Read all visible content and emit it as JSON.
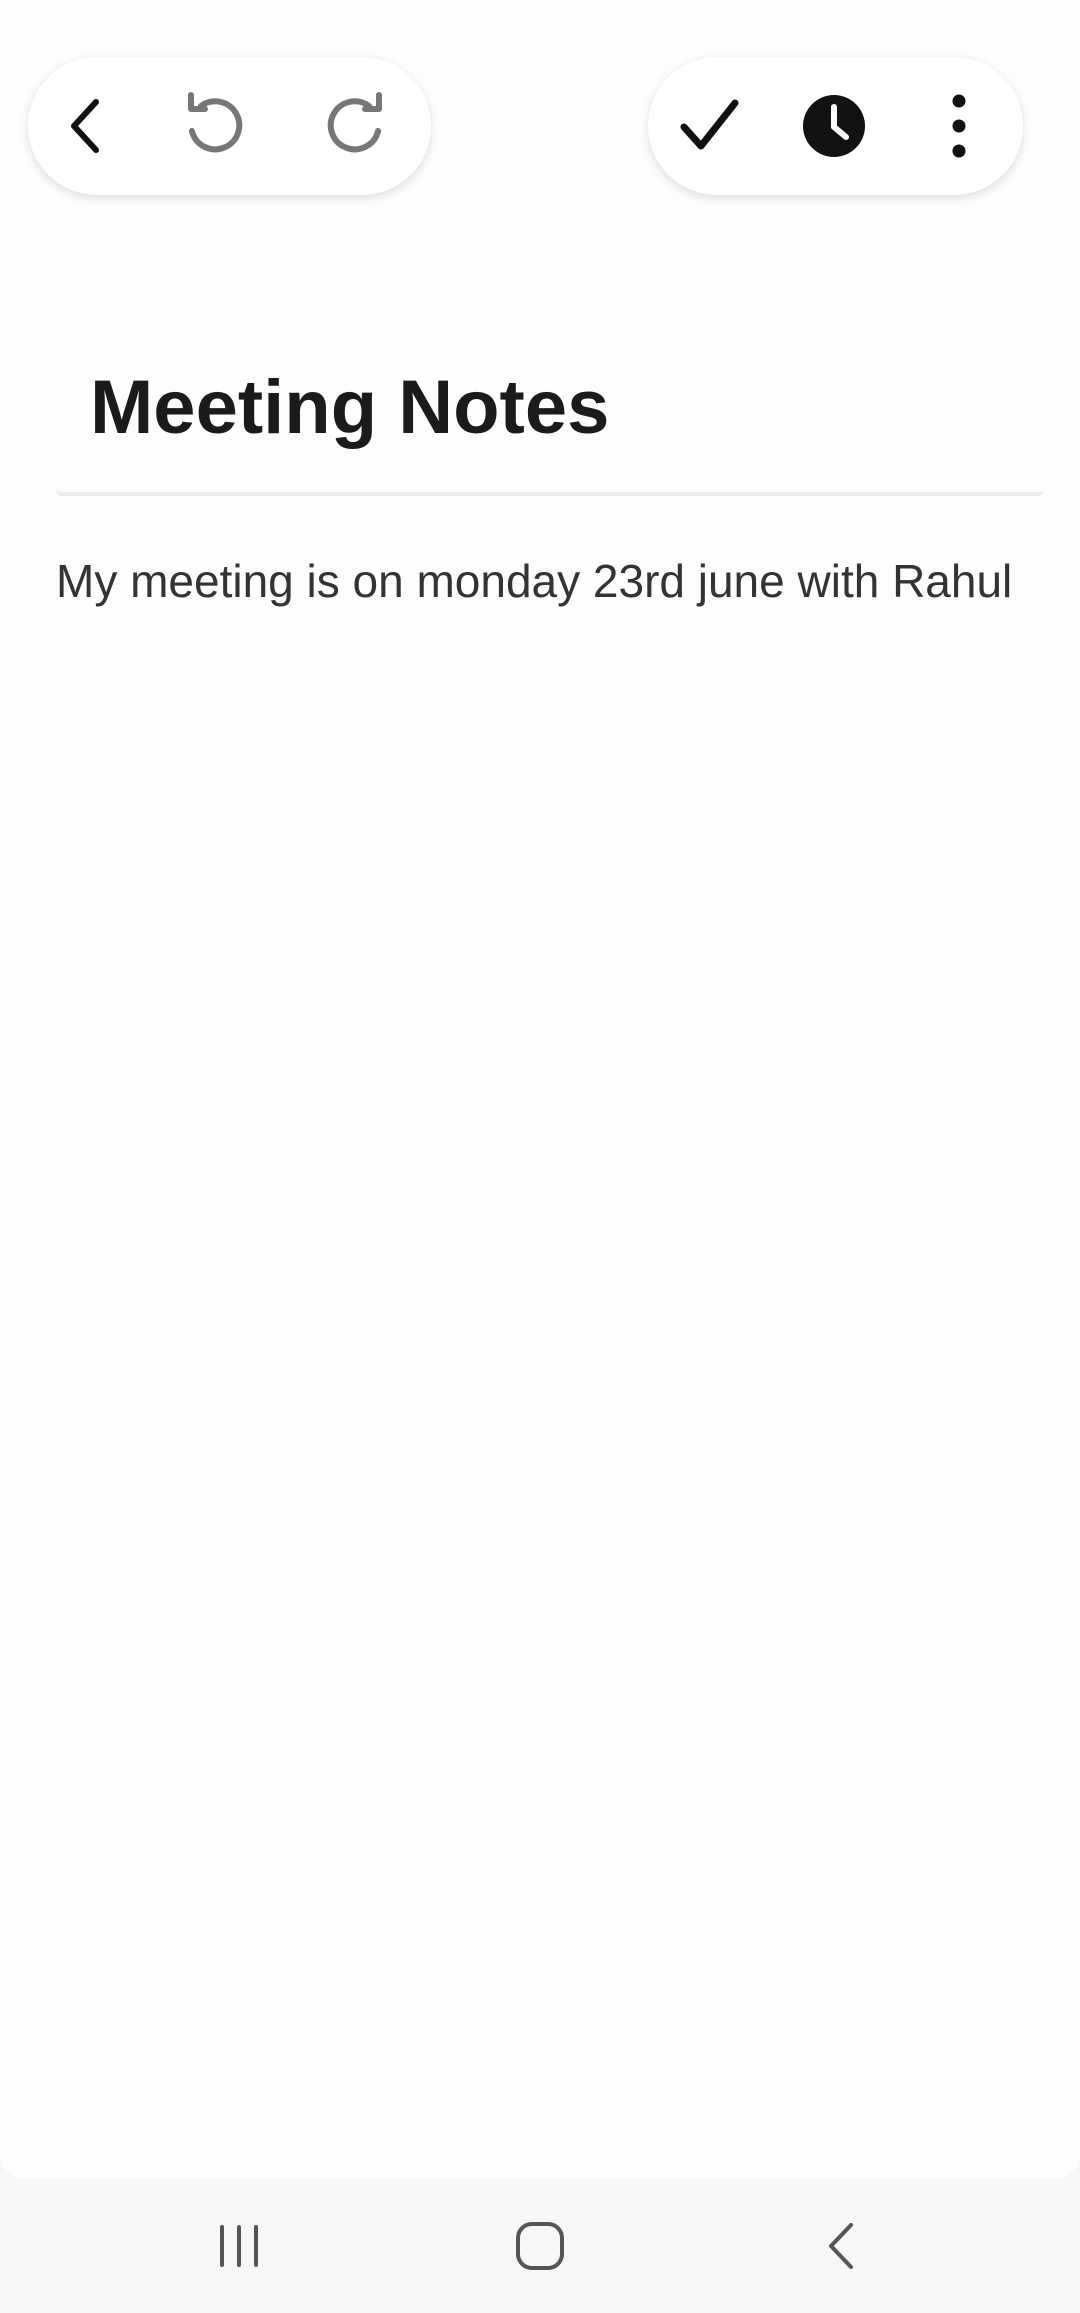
{
  "toolbar": {
    "left": [
      {
        "icon": "back-arrow-icon",
        "label": "Back"
      },
      {
        "icon": "undo-icon",
        "label": "Undo"
      },
      {
        "icon": "redo-icon",
        "label": "Redo"
      }
    ],
    "right": [
      {
        "icon": "checkmark-icon",
        "label": "Save"
      },
      {
        "icon": "clock-icon",
        "label": "Reminder"
      },
      {
        "icon": "more-vertical-icon",
        "label": "More options"
      }
    ]
  },
  "note": {
    "title": "Meeting Notes",
    "body": "My meeting is on monday 23rd june with Rahul"
  },
  "navbar": {
    "items": [
      {
        "icon": "recent-apps-icon"
      },
      {
        "icon": "home-icon"
      },
      {
        "icon": "nav-back-icon"
      }
    ]
  },
  "colors": {
    "icon_dark": "#111111",
    "icon_muted": "#777777",
    "background": "#fdfdfd",
    "text": "#333333"
  }
}
